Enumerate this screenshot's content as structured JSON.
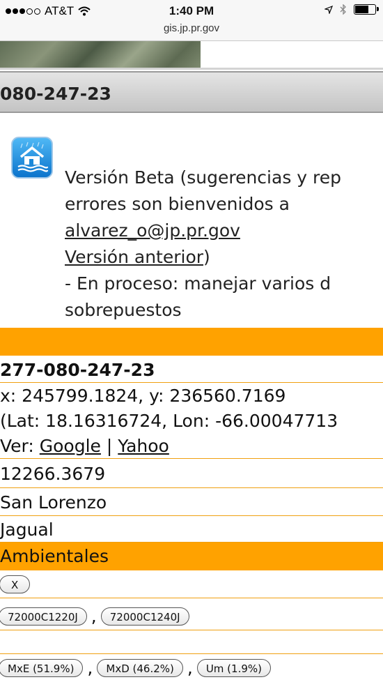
{
  "status_bar": {
    "carrier": "AT&T",
    "time": "1:40 PM",
    "url": "gis.jp.pr.gov"
  },
  "parcel_header": "080-247-23",
  "info": {
    "line1": "Versión Beta (sugerencias y rep",
    "line2": "errores son bienvenidos a",
    "email": "alvarez_o@jp.pr.gov",
    "prev_version_link": "Versión anterior",
    "prev_version_suffix": ")",
    "line5": "- En proceso: manejar varios d",
    "line6": "sobrepuestos"
  },
  "details": {
    "parcel_id": "277-080-247-23",
    "coords_xy": "x: 245799.1824, y: 236560.7169",
    "coords_latlon": "(Lat: 18.16316724, Lon: -66.00047713",
    "ver_label": "Ver: ",
    "google": "Google",
    "pipe": " | ",
    "yahoo": "Yahoo",
    "area": "12266.3679",
    "municipio": "San Lorenzo",
    "barrio": "Jagual",
    "ambientales_header": "Ambientales"
  },
  "buttons": {
    "x_label": "X",
    "panel1": "72000C1220J",
    "panel2": "72000C1240J",
    "soil1": "MxE (51.9%)",
    "soil2": "MxD (46.2%)",
    "soil3": "Um (1.9%)",
    "comma": ","
  }
}
